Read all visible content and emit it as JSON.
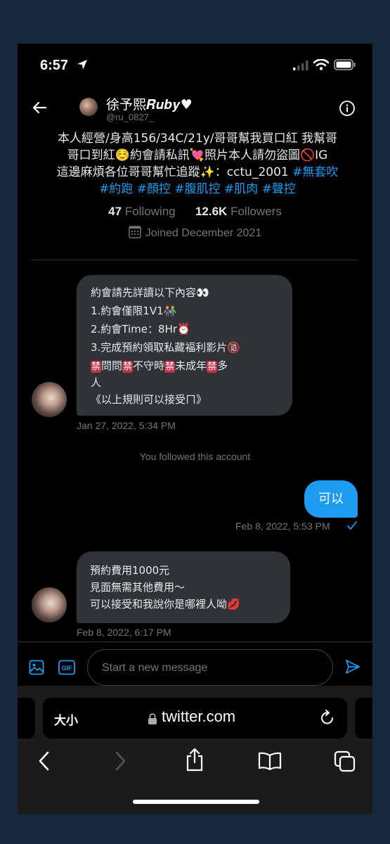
{
  "status_bar": {
    "time": "6:57"
  },
  "profile": {
    "name": "徐予熙𝑹𝒖𝒃𝒚♥",
    "handle": "@ru_0827_",
    "bio_line1": "本人經營/身高156/34C/21y/哥哥幫我買口紅 我幫哥",
    "bio_line2": "哥口到紅☺️約會請私訊💘照片本人請勿盜圖🚫IG",
    "bio_line3_text": "這邊麻煩各位哥哥幫忙追蹤✨：cctu_2001 ",
    "bio_line3_tag": "#無套吹",
    "hashtags": [
      "#約跑",
      "#顏控",
      "#腹肌控",
      "#肌肉",
      "#聲控"
    ],
    "following_count": "47",
    "following_label": "Following",
    "followers_count": "12.6K",
    "followers_label": "Followers",
    "joined": "Joined December 2021"
  },
  "messages": {
    "msg1": {
      "line1": "約會請先詳讀以下內容👀",
      "line2": "1.約會僅限1V1👫",
      "line3": "2.約會Time：8Hr⏰",
      "line4": "3.完成預約領取私藏福利影片🔞",
      "ban": "禁",
      "rule1": "問問",
      "rule2": "不守時",
      "rule3": "未成年",
      "rule4": "多",
      "line6": "人",
      "line7": "《以上規則可以接受ㄇ》",
      "timestamp": "Jan 27, 2022, 5:34 PM"
    },
    "followed_notice": "You followed this account",
    "reply": {
      "text": "可以",
      "timestamp": "Feb 8, 2022, 5:53 PM"
    },
    "msg2": {
      "line1": "預約費用1000元",
      "line2": "見面無需其他費用～",
      "line3": "可以接受和我說你是哪裡人呦💋",
      "timestamp": "Feb 8, 2022, 6:17 PM"
    }
  },
  "composer": {
    "placeholder": "Start a new message",
    "gif_label": "GIF"
  },
  "browser": {
    "text_size_label": "大小",
    "url": "twitter.com"
  },
  "colors": {
    "accent": "#1d9bf0",
    "bubble_in": "#2f3336",
    "muted": "#71767b"
  }
}
